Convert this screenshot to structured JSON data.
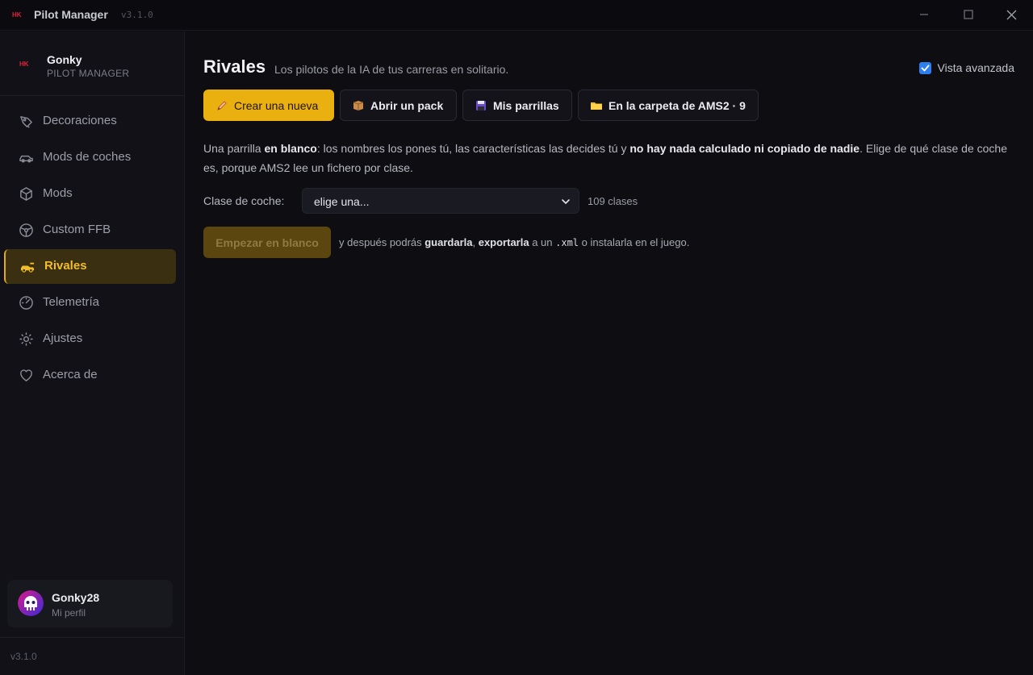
{
  "window": {
    "title": "Pilot Manager",
    "version": "v3.1.0"
  },
  "sidebar": {
    "brand": {
      "name": "Gonky",
      "subtitle": "PILOT MANAGER"
    },
    "items": [
      {
        "label": "Decoraciones",
        "icon": "brush-icon",
        "active": false
      },
      {
        "label": "Mods de coches",
        "icon": "car-icon",
        "active": false
      },
      {
        "label": "Mods",
        "icon": "cube-icon",
        "active": false
      },
      {
        "label": "Custom FFB",
        "icon": "steering-wheel-icon",
        "active": false
      },
      {
        "label": "Rivales",
        "icon": "racing-car-icon",
        "active": true
      },
      {
        "label": "Telemetría",
        "icon": "gauge-icon",
        "active": false
      },
      {
        "label": "Ajustes",
        "icon": "gear-icon",
        "active": false
      },
      {
        "label": "Acerca de",
        "icon": "heart-icon",
        "active": false
      }
    ],
    "profile": {
      "name": "Gonky28",
      "subtitle": "Mi perfil"
    },
    "version": "v3.1.0"
  },
  "main": {
    "title": "Rivales",
    "subtitle": "Los pilotos de la IA de tus carreras en solitario.",
    "advanced_view": {
      "label": "Vista avanzada",
      "checked": true
    },
    "tabs": [
      {
        "label": "Crear una nueva",
        "icon": "pencil-icon",
        "primary": true
      },
      {
        "label": "Abrir un pack",
        "icon": "package-icon",
        "primary": false
      },
      {
        "label": "Mis parrillas",
        "icon": "floppy-icon",
        "primary": false
      },
      {
        "label": "En la carpeta de AMS2 · 9",
        "icon": "folder-icon",
        "primary": false
      }
    ],
    "description": {
      "p1": "Una parrilla ",
      "b1": "en blanco",
      "p2": ": los nombres los pones tú, las características las decides tú y ",
      "b2": "no hay nada calculado ni copiado de nadie",
      "p3": ". Elige de qué clase de coche es, porque AMS2 lee un fichero por clase."
    },
    "car_class": {
      "label": "Clase de coche:",
      "value": "elige una...",
      "count": "109 clases"
    },
    "start": {
      "button": "Empezar en blanco",
      "t1": "y después podrás ",
      "b1": "guardarla",
      "t2": ", ",
      "b2": "exportarla",
      "t3": " a un ",
      "code": ".xml",
      "t4": " o instalarla en el juego."
    }
  },
  "colors": {
    "accent": "#eab010",
    "active_nav_bg": "#3a2f10",
    "checkbox": "#2d7ff0",
    "background": "#0d0d12"
  }
}
